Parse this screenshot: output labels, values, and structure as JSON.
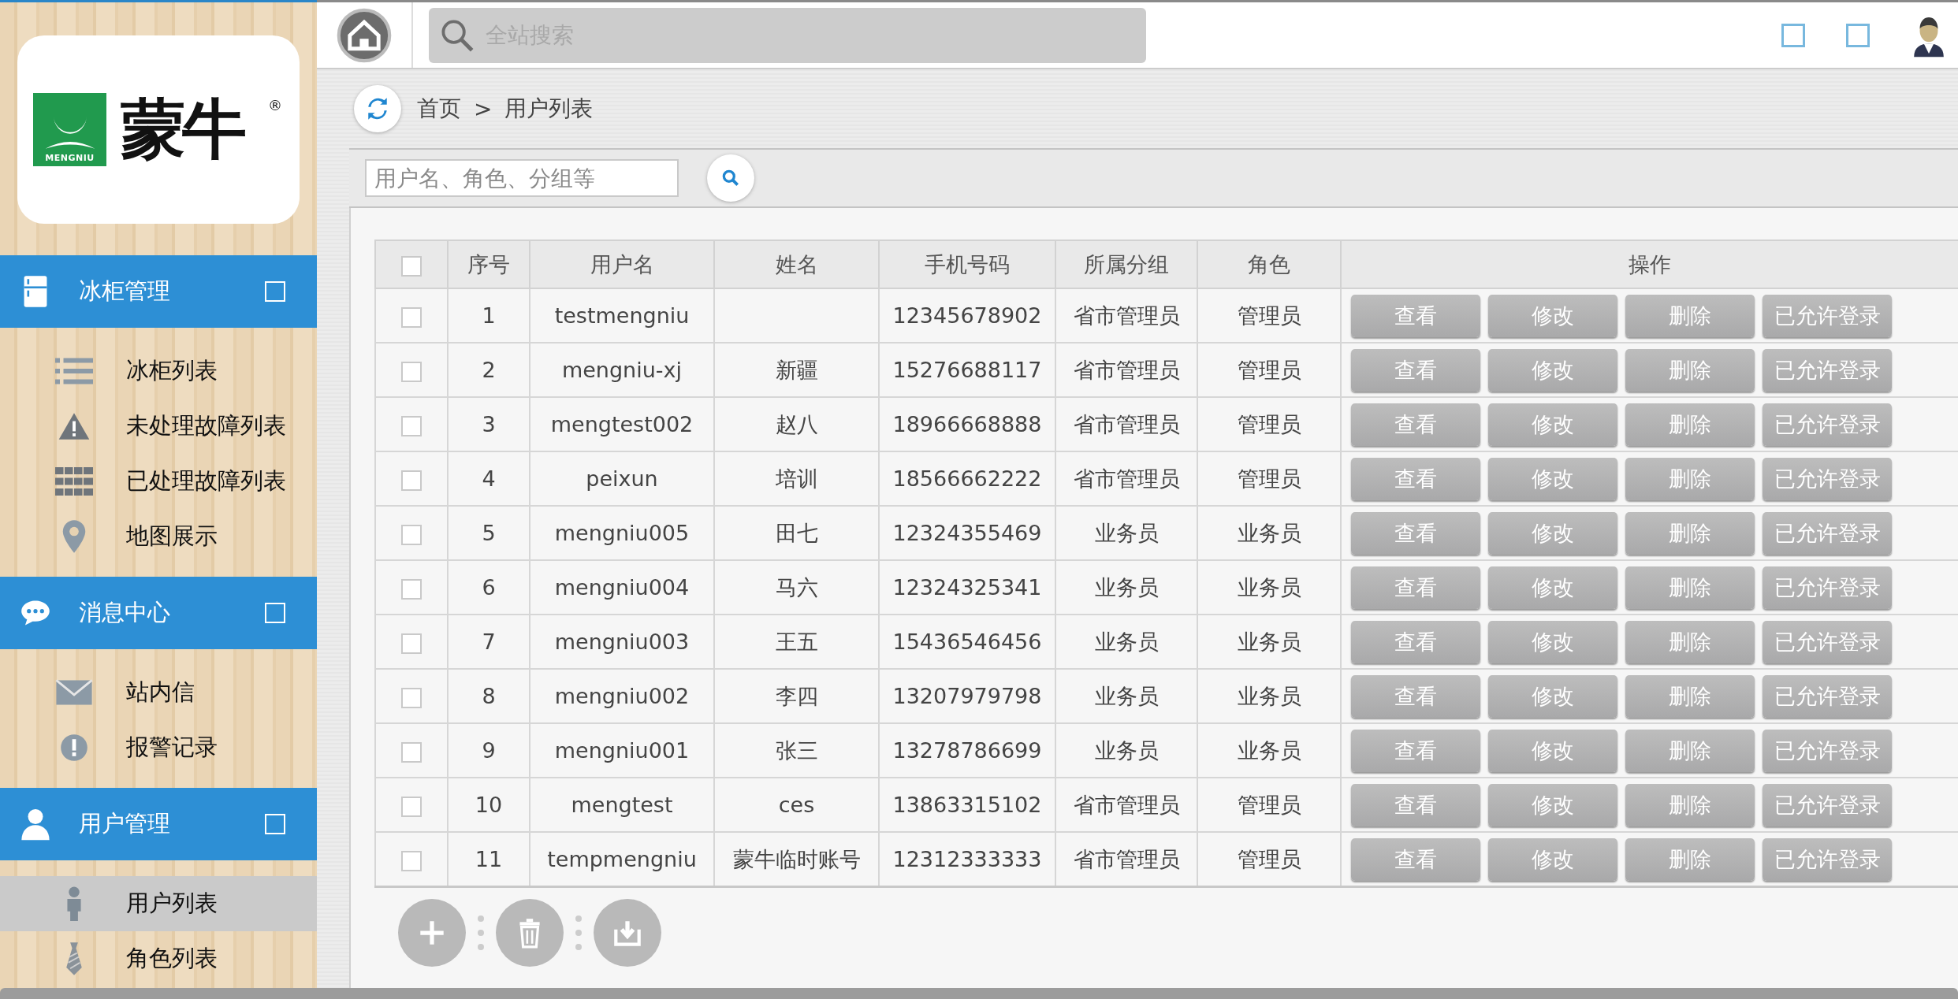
{
  "logo": {
    "mark_text": "MENGNIU",
    "brand": "蒙牛",
    "registered": "®"
  },
  "sidebar": {
    "sections": [
      {
        "title": "冰柜管理",
        "items": [
          {
            "label": "冰柜列表",
            "selected": false
          },
          {
            "label": "未处理故障列表",
            "selected": false
          },
          {
            "label": "已处理故障列表",
            "selected": false
          },
          {
            "label": "地图展示",
            "selected": false
          }
        ]
      },
      {
        "title": "消息中心",
        "items": [
          {
            "label": "站内信",
            "selected": false
          },
          {
            "label": "报警记录",
            "selected": false
          }
        ]
      },
      {
        "title": "用户管理",
        "items": [
          {
            "label": "用户列表",
            "selected": true
          },
          {
            "label": "角色列表",
            "selected": false
          }
        ]
      }
    ]
  },
  "topbar": {
    "search": {
      "placeholder": "全站搜索"
    }
  },
  "breadcrumb": {
    "home": "首页",
    "separator": ">",
    "current": "用户列表"
  },
  "filter": {
    "placeholder": "用户名、角色、分组等"
  },
  "table": {
    "header_checked": false,
    "columns": [
      "序号",
      "用户名",
      "姓名",
      "手机号码",
      "所属分组",
      "角色",
      "操作"
    ],
    "rows": [
      {
        "checked": false,
        "cells": [
          "1",
          "testmengniu",
          "",
          "12345678902",
          "省市管理员",
          "管理员"
        ],
        "actions": [
          "查看",
          "修改",
          "删除",
          "已允许登录"
        ]
      },
      {
        "checked": false,
        "cells": [
          "2",
          "mengniu-xj",
          "新疆",
          "15276688117",
          "省市管理员",
          "管理员"
        ],
        "actions": [
          "查看",
          "修改",
          "删除",
          "已允许登录"
        ]
      },
      {
        "checked": false,
        "cells": [
          "3",
          "mengtest002",
          "赵八",
          "18966668888",
          "省市管理员",
          "管理员"
        ],
        "actions": [
          "查看",
          "修改",
          "删除",
          "已允许登录"
        ]
      },
      {
        "checked": false,
        "cells": [
          "4",
          "peixun",
          "培训",
          "18566662222",
          "省市管理员",
          "管理员"
        ],
        "actions": [
          "查看",
          "修改",
          "删除",
          "已允许登录"
        ]
      },
      {
        "checked": false,
        "cells": [
          "5",
          "mengniu005",
          "田七",
          "12324355469",
          "业务员",
          "业务员"
        ],
        "actions": [
          "查看",
          "修改",
          "删除",
          "已允许登录"
        ]
      },
      {
        "checked": false,
        "cells": [
          "6",
          "mengniu004",
          "马六",
          "12324325341",
          "业务员",
          "业务员"
        ],
        "actions": [
          "查看",
          "修改",
          "删除",
          "已允许登录"
        ]
      },
      {
        "checked": false,
        "cells": [
          "7",
          "mengniu003",
          "王五",
          "15436546456",
          "业务员",
          "业务员"
        ],
        "actions": [
          "查看",
          "修改",
          "删除",
          "已允许登录"
        ]
      },
      {
        "checked": false,
        "cells": [
          "8",
          "mengniu002",
          "李四",
          "13207979798",
          "业务员",
          "业务员"
        ],
        "actions": [
          "查看",
          "修改",
          "删除",
          "已允许登录"
        ]
      },
      {
        "checked": false,
        "cells": [
          "9",
          "mengniu001",
          "张三",
          "13278786699",
          "业务员",
          "业务员"
        ],
        "actions": [
          "查看",
          "修改",
          "删除",
          "已允许登录"
        ]
      },
      {
        "checked": false,
        "cells": [
          "10",
          "mengtest",
          "ces",
          "13863315102",
          "省市管理员",
          "管理员"
        ],
        "actions": [
          "查看",
          "修改",
          "删除",
          "已允许登录"
        ]
      },
      {
        "checked": false,
        "cells": [
          "11",
          "tempmengniu",
          "蒙牛临时账号",
          "12312333333",
          "省市管理员",
          "管理员"
        ],
        "actions": [
          "查看",
          "修改",
          "删除",
          "已允许登录"
        ]
      }
    ]
  }
}
